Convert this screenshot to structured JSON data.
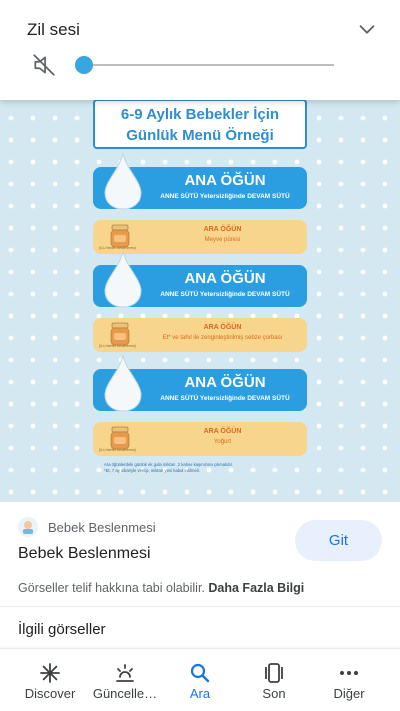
{
  "volume_panel": {
    "title": "Zil sesi",
    "level_fraction": 0.0,
    "accent_color": "#38a6e0",
    "icons": [
      "chevron-down-icon",
      "speaker-muted-icon"
    ]
  },
  "image": {
    "heading_line1": "6-9 Aylık Bebekler İçin",
    "heading_line2": "Günlük Menü Örneği",
    "meals": [
      {
        "kind": "main",
        "title": "ANA ÖĞÜN",
        "subtitle": "ANNE SÜTÜ Yetersizliğinde DEVAM SÜTÜ"
      },
      {
        "kind": "snack",
        "title": "ARA ÖĞÜN",
        "subtitle": "Meyve püresi",
        "jar_label": "(ILU bebek beslenmesi)"
      },
      {
        "kind": "main",
        "title": "ANA ÖĞÜN",
        "subtitle": "ANNE SÜTÜ Yetersizliğinde DEVAM SÜTÜ"
      },
      {
        "kind": "snack",
        "title": "ARA ÖĞÜN",
        "subtitle": "Et* ve tahıl ile zenginleştirilmiş sebze çorbası",
        "jar_label": "(ILU bebek beslenmesi)"
      },
      {
        "kind": "main",
        "title": "ANA ÖĞÜN",
        "subtitle": "ANNE SÜTÜ Yetersizliğinde DEVAM SÜTÜ"
      },
      {
        "kind": "snack",
        "title": "ARA ÖĞÜN",
        "subtitle": "Yoğurt",
        "jar_label": "(ILU bebek beslenmesi)"
      }
    ],
    "footnote_line1": "Ara öğünlerdeki günlük ek gıda miktarı, 2 kahve kaşınızına çıkmalıdır.",
    "footnote_line2": "*Et, 7 ay itibariyle verilip, miktarı yeni kabul edilmeli.",
    "colors": {
      "main": "#2a9ee0",
      "snack": "#f7d58c",
      "background": "#d4e8f2"
    }
  },
  "result": {
    "source_name": "Bebek Beslenmesi",
    "title": "Bebek Beslenmesi",
    "visit_label": "Git",
    "copyright_text": "Görseller telif hakkına tabi olabilir.",
    "learn_more": "Daha Fazla Bilgi",
    "related_label": "İlgili görseller"
  },
  "bottom_nav": {
    "items": [
      {
        "label": "Discover",
        "icon": "asterisk-icon"
      },
      {
        "label": "Güncelle…",
        "icon": "updates-icon"
      },
      {
        "label": "Ara",
        "icon": "search-icon",
        "active": true
      },
      {
        "label": "Son",
        "icon": "recent-tabs-icon"
      },
      {
        "label": "Diğer",
        "icon": "more-dots-icon"
      }
    ],
    "active_color": "#1a73e8"
  }
}
